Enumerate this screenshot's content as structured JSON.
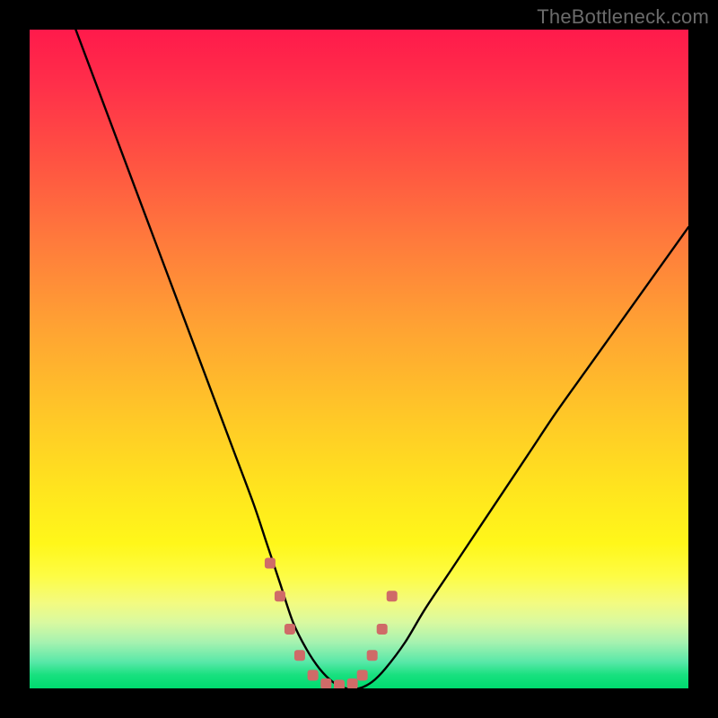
{
  "watermark": "TheBottleneck.com",
  "colors": {
    "curve_stroke": "#000000",
    "marker_fill": "#cf6b68",
    "background": "#000000"
  },
  "chart_data": {
    "type": "line",
    "title": "",
    "xlabel": "",
    "ylabel": "",
    "xlim": [
      0,
      100
    ],
    "ylim": [
      0,
      100
    ],
    "series": [
      {
        "name": "bottleneck-curve",
        "x": [
          7,
          10,
          13,
          16,
          19,
          22,
          25,
          28,
          31,
          34,
          36,
          38,
          40,
          42,
          44,
          46,
          48,
          50,
          52,
          54,
          57,
          60,
          64,
          68,
          72,
          76,
          80,
          85,
          90,
          95,
          100
        ],
        "y": [
          100,
          92,
          84,
          76,
          68,
          60,
          52,
          44,
          36,
          28,
          22,
          16,
          10,
          6,
          3,
          1,
          0,
          0,
          1,
          3,
          7,
          12,
          18,
          24,
          30,
          36,
          42,
          49,
          56,
          63,
          70
        ]
      }
    ],
    "markers": {
      "name": "valley-dots",
      "x": [
        36.5,
        38,
        39.5,
        41,
        43,
        45,
        47,
        49,
        50.5,
        52,
        53.5,
        55
      ],
      "y": [
        19,
        14,
        9,
        5,
        2,
        0.7,
        0.5,
        0.7,
        2,
        5,
        9,
        14
      ]
    }
  }
}
